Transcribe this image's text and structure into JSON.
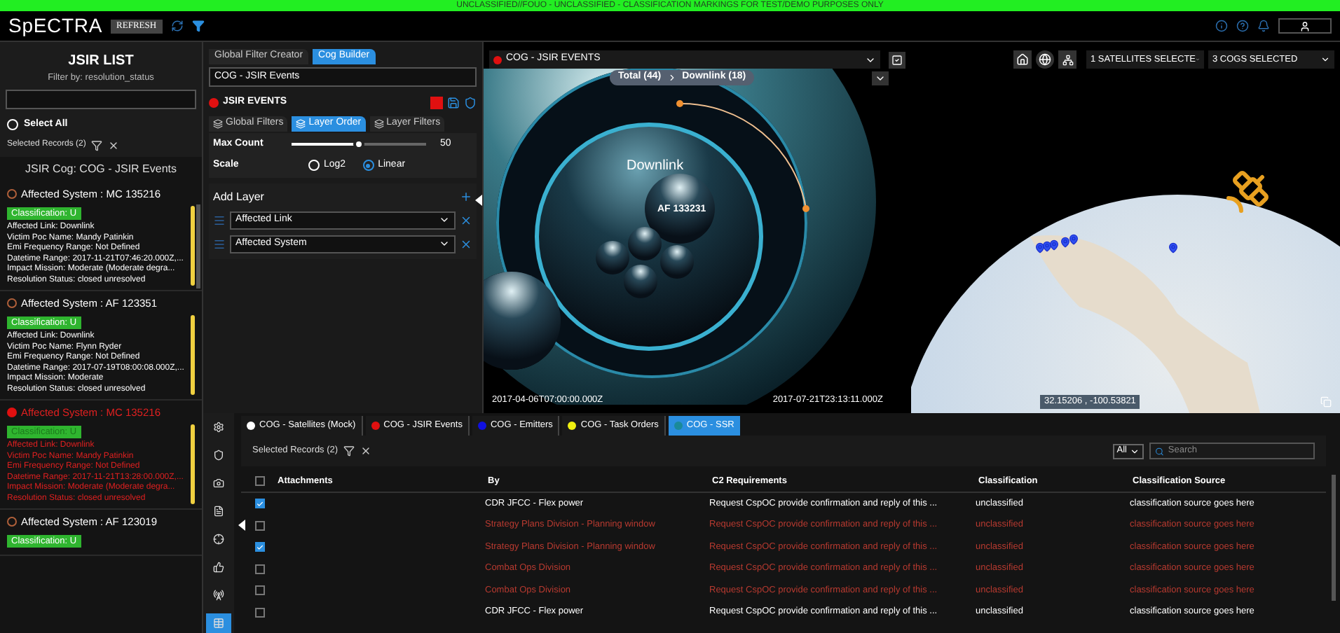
{
  "banner": {
    "text": "UNCLASSIFIED//FOUO - UNCLASSIFIED - CLASSIFICATION MARKINGS FOR TEST/DEMO PURPOSES ONLY"
  },
  "header": {
    "logo": "SpECTRA",
    "refresh": "REFRESH"
  },
  "jsir_list": {
    "title": "JSIR LIST",
    "subtitle": "Filter by: resolution_status",
    "select_all": {
      "label": "Select All",
      "checked": false
    },
    "selected_records": "Selected Records (2)",
    "group_title": "JSIR Cog: COG - JSIR Events",
    "records": [
      {
        "title": "Affected System : MC 135216",
        "selected": false,
        "badge": "Classification: U",
        "lines": [
          "Affected Link: Downlink",
          "Victim Poc Name: Mandy Patinkin",
          "Emi Frequency Range: Not Defined",
          "Datetime Range: 2017-11-21T07:46:20.000Z,...",
          "Impact Mission: Moderate (Moderate degra...",
          "Resolution Status: closed unresolved"
        ]
      },
      {
        "title": "Affected System : AF 123351",
        "selected": false,
        "badge": "Classification: U",
        "lines": [
          "Affected Link: Downlink",
          "Victim Poc Name: Flynn Ryder",
          "Emi Frequency Range: Not Defined",
          "Datetime Range: 2017-07-19T08:00:08.000Z,...",
          "Impact Mission: Moderate",
          "Resolution Status: closed unresolved"
        ]
      },
      {
        "title": "Affected System : MC 135216",
        "selected": true,
        "badge": "Classification: U",
        "lines": [
          "Affected Link: Downlink",
          "Victim Poc Name: Mandy Patinkin",
          "Emi Frequency Range: Not Defined",
          "Datetime Range: 2017-11-21T13:28:00.000Z,...",
          "Impact Mission: Moderate (Moderate degra...",
          "Resolution Status: closed unresolved"
        ]
      },
      {
        "title": "Affected System : AF 123019",
        "selected": false,
        "badge": "Classification: U"
      }
    ]
  },
  "cog_builder": {
    "tabs": [
      {
        "label": "Global Filter Creator",
        "selected": false
      },
      {
        "label": "Cog Builder",
        "selected": true
      }
    ],
    "name_value": "COG - JSIR Events",
    "layer": {
      "label": "JSIR EVENTS",
      "color": "#e01010"
    },
    "sub_tabs": [
      {
        "label": "Global Filters",
        "selected": false
      },
      {
        "label": "Layer Order",
        "selected": true
      },
      {
        "label": "Layer Filters",
        "selected": false
      }
    ],
    "max_count": {
      "label": "Max Count",
      "level": 0.5,
      "reading": "50"
    },
    "scale": {
      "label": "Scale",
      "options": [
        {
          "label": "Log2",
          "selected": false
        },
        {
          "label": "Linear",
          "selected": true
        }
      ]
    },
    "add_layer": "Add Layer",
    "layers": [
      {
        "value": "Affected Link"
      },
      {
        "value": "Affected System"
      }
    ]
  },
  "viz": {
    "cog_select": {
      "value": "COG - JSIR EVENTS",
      "color": "#e01010"
    },
    "breadcrumb": [
      "Total (44)",
      "Downlink (18)"
    ],
    "group_label": "Downlink",
    "top_bubble": "AF 133231",
    "start_time": "2017-04-06T07:00:00.000Z",
    "end_time": "2017-07-21T23:13:11.000Z"
  },
  "map": {
    "satellites_select": "1 SATELLITES SELECTE",
    "cogs_select": "3 COGS SELECTED",
    "coordinates": "32.15206 , -100.53821"
  },
  "side_rail": {
    "items": [
      {
        "kind": "settings",
        "selected": false
      },
      {
        "kind": "shield",
        "selected": false
      },
      {
        "kind": "camera",
        "selected": false
      },
      {
        "kind": "file",
        "selected": false
      },
      {
        "kind": "target",
        "selected": false
      },
      {
        "kind": "thumb",
        "selected": false
      },
      {
        "kind": "tower",
        "selected": false
      },
      {
        "kind": "table",
        "selected": true
      }
    ]
  },
  "grid": {
    "tabs": [
      {
        "label": "COG - Satellites (Mock)",
        "color": "#ffffff",
        "selected": false
      },
      {
        "label": "COG - JSIR Events",
        "color": "#e01010",
        "selected": false
      },
      {
        "label": "COG - Emitters",
        "color": "#1010e0",
        "selected": false
      },
      {
        "label": "COG - Task Orders",
        "color": "#f0f010",
        "selected": false
      },
      {
        "label": "COG - SSR",
        "color": "#1a8a9a",
        "selected": true
      }
    ],
    "selected_records": "Selected Records (2)",
    "select_all_checked": false,
    "filter_select": "All",
    "search": {
      "placeholder": "Search"
    },
    "columns": [
      "Attachments",
      "By",
      "C2 Requirements",
      "Classification",
      "Classification Source"
    ],
    "rows": [
      {
        "checked": true,
        "alert": false,
        "by": "CDR JFCC - Flex power",
        "c2": "Request CspOC provide confirmation and reply of this ...",
        "classification": "unclassified",
        "source": "classification source goes here"
      },
      {
        "checked": false,
        "alert": true,
        "by": "Strategy Plans Division - Planning window",
        "c2": "Request CspOC provide confirmation and reply of this ...",
        "classification": "unclassified",
        "source": "classification source goes here"
      },
      {
        "checked": true,
        "alert": true,
        "by": "Strategy Plans Division - Planning window",
        "c2": "Request CspOC provide confirmation and reply of this ...",
        "classification": "unclassified",
        "source": "classification source goes here"
      },
      {
        "checked": false,
        "alert": true,
        "by": "Combat Ops Division",
        "c2": "Request CspOC provide confirmation and reply of this ...",
        "classification": "unclassified",
        "source": "classification source goes here"
      },
      {
        "checked": false,
        "alert": true,
        "by": "Combat Ops Division",
        "c2": "Request CspOC provide confirmation and reply of this ...",
        "classification": "unclassified",
        "source": "classification source goes here"
      },
      {
        "checked": false,
        "alert": false,
        "by": "CDR JFCC - Flex power",
        "c2": "Request CspOC provide confirmation and reply of this ...",
        "classification": "unclassified",
        "source": "classification source goes here"
      }
    ]
  }
}
